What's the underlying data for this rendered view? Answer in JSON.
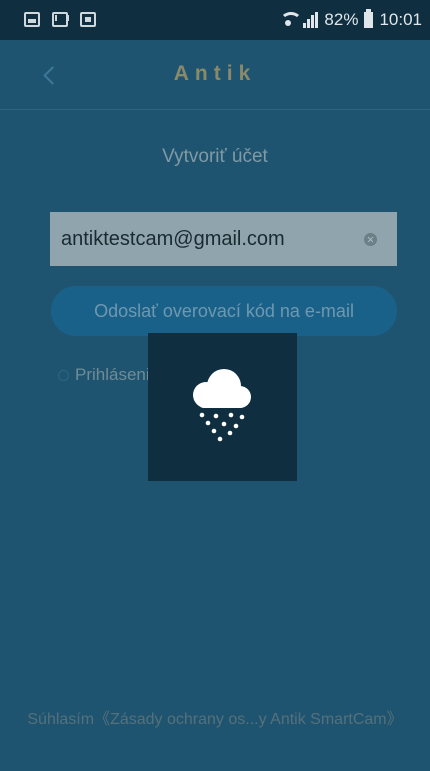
{
  "status_bar": {
    "left_icons": [
      "image-notification-icon",
      "mail-icon",
      "screen-cast-icon"
    ],
    "right_icons": [
      "wifi-icon",
      "signal-icon",
      "battery-icon"
    ],
    "battery": "82%",
    "time": "10:01"
  },
  "header": {
    "back_icon": "chevron-left-icon",
    "title": "Antik"
  },
  "form": {
    "section_title": "Vytvoriť účet",
    "email_value": "antiktestcam@gmail.com",
    "clear_icon": "clear-circle-icon",
    "send_button_label": "Odoslať overovací kód na e-mail",
    "login_label": "Prihlásenie"
  },
  "footer": {
    "consent_text": "Súhlasím《Zásady ochrany os...y Antik SmartCam》"
  },
  "loader": {
    "icon": "cloud-snow-icon"
  },
  "colors": {
    "background": "#1f5470",
    "status_bar": "#0f2f40",
    "button": "#1a618a",
    "field": "#8fa4ad",
    "loader": "#0f2f40"
  }
}
